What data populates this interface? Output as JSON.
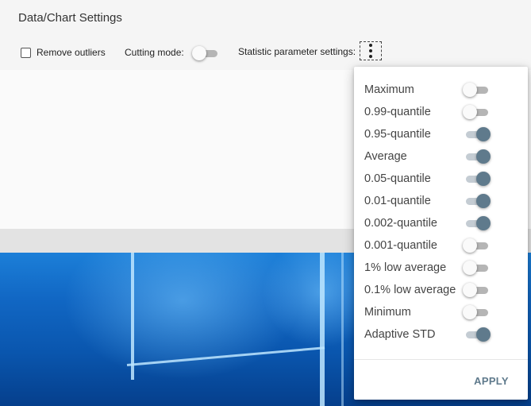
{
  "window": {
    "title": "Data/Chart Settings"
  },
  "toolbar": {
    "remove_outliers_label": "Remove outliers",
    "remove_outliers_checked": false,
    "cutting_mode_label": "Cutting mode:",
    "cutting_mode_on": false,
    "statistic_settings_label": "Statistic parameter settings:",
    "menu_icon": "more-vert-icon"
  },
  "menu": {
    "items": [
      {
        "label": "Maximum",
        "on": false
      },
      {
        "label": "0.99-quantile",
        "on": false
      },
      {
        "label": "0.95-quantile",
        "on": true
      },
      {
        "label": "Average",
        "on": true
      },
      {
        "label": "0.05-quantile",
        "on": true
      },
      {
        "label": "0.01-quantile",
        "on": true
      },
      {
        "label": "0.002-quantile",
        "on": true
      },
      {
        "label": "0.001-quantile",
        "on": false
      },
      {
        "label": "1% low average",
        "on": false
      },
      {
        "label": "0.1% low average",
        "on": false
      },
      {
        "label": "Minimum",
        "on": false
      },
      {
        "label": "Adaptive STD",
        "on": true
      }
    ],
    "apply_label": "APPLY"
  },
  "colors": {
    "accent": "#5f7a8c",
    "toggle_off_track": "#b5b5b5",
    "window_bg": "#f5f5f5"
  }
}
